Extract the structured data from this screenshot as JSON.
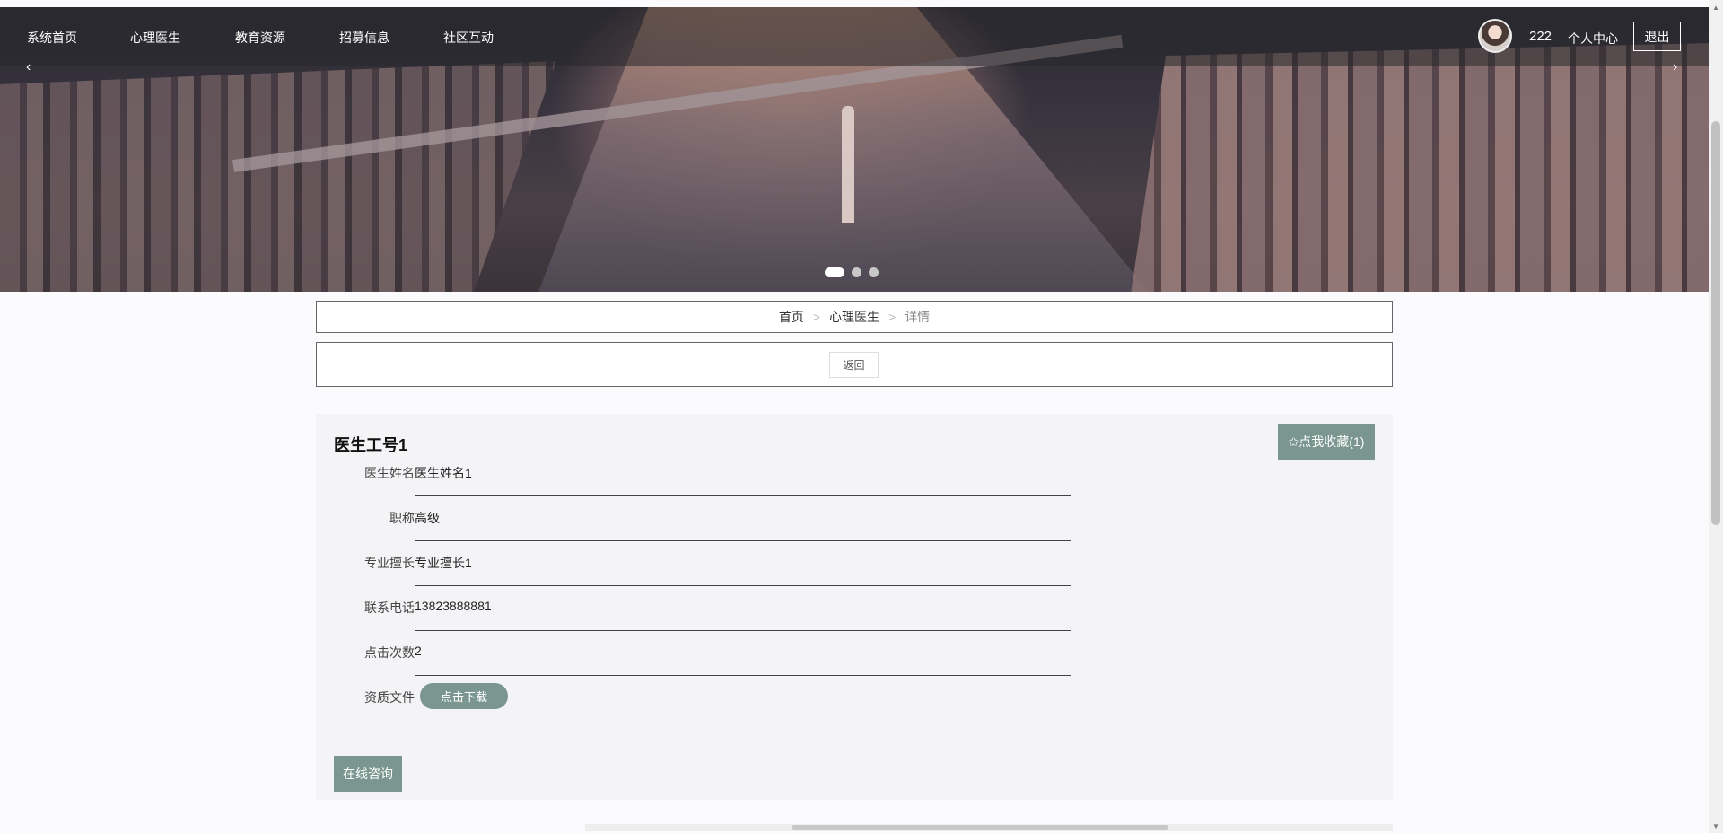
{
  "nav": {
    "items": [
      "系统首页",
      "心理医生",
      "教育资源",
      "招募信息",
      "社区互动"
    ],
    "username": "222",
    "personal_center": "个人中心",
    "logout": "退出"
  },
  "carousel": {
    "prev": "‹",
    "next": "›",
    "slide_count": 3,
    "active_slide": 1
  },
  "breadcrumb": {
    "home": "首页",
    "section": "心理医生",
    "current": "详情",
    "separator": ">"
  },
  "back_button": "返回",
  "detail": {
    "title": "医生工号1",
    "favorite_button": "✩点我收藏(1)",
    "fields": [
      {
        "label": "医生姓名",
        "value": "医生姓名1"
      },
      {
        "label": "职称",
        "value": "高级"
      },
      {
        "label": "专业擅长",
        "value": "专业擅长1"
      },
      {
        "label": "联系电话",
        "value": "13823888881"
      },
      {
        "label": "点击次数",
        "value": "2"
      }
    ],
    "file_label": "资质文件",
    "download_button": "点击下载",
    "consult_button": "在线咨询"
  },
  "colors": {
    "accent": "#7a968f",
    "nav_overlay": "#28282c"
  }
}
